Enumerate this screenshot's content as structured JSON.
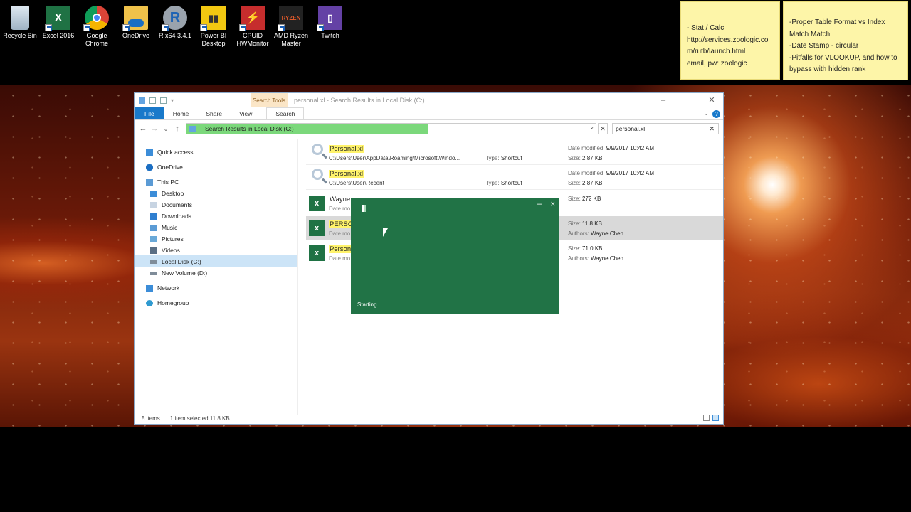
{
  "desktop": {
    "icons": [
      {
        "label": "Recycle Bin",
        "icon": "recycle-bin-icon"
      },
      {
        "label": "Excel 2016",
        "icon": "excel-icon"
      },
      {
        "label": "Google Chrome",
        "icon": "chrome-icon"
      },
      {
        "label": "OneDrive",
        "icon": "onedrive-icon"
      },
      {
        "label": "R x64 3.4.1",
        "icon": "r-icon"
      },
      {
        "label": "Power BI Desktop",
        "icon": "powerbi-icon"
      },
      {
        "label": "CPUID HWMonitor",
        "icon": "hwmonitor-icon"
      },
      {
        "label": "AMD Ryzen Master",
        "icon": "ryzen-icon"
      },
      {
        "label": "Twitch",
        "icon": "twitch-icon"
      }
    ],
    "sticky_notes": [
      {
        "lines": [
          "- Stat / Calc",
          "http://services.zoologic.co",
          "m/rutb/launch.html",
          "email, pw: zoologic"
        ]
      },
      {
        "lines": [
          "-Proper Table Format vs Index",
          "Match Match",
          "-Date Stamp - circular",
          "-Pitfalls for VLOOKUP, and how to",
          "bypass with hidden rank"
        ]
      }
    ]
  },
  "explorer": {
    "title": "personal.xl - Search Results in Local Disk (C:)",
    "contextual_tab": "Search Tools",
    "ribbon_tabs": [
      "File",
      "Home",
      "Share",
      "View",
      "Search"
    ],
    "address": "Search Results in Local Disk (C:)",
    "search_value": "personal.xl",
    "nav": {
      "quick_access": "Quick access",
      "onedrive": "OneDrive",
      "this_pc": "This PC",
      "desktop": "Desktop",
      "documents": "Documents",
      "downloads": "Downloads",
      "music": "Music",
      "pictures": "Pictures",
      "videos": "Videos",
      "local_disk": "Local Disk (C:)",
      "new_volume": "New Volume (D:)",
      "network": "Network",
      "homegroup": "Homegroup"
    },
    "results": [
      {
        "name": "Personal.xl",
        "path": "C:\\Users\\User\\AppData\\Roaming\\Microsoft\\Windo...",
        "type_label": "Type:",
        "type": "Shortcut",
        "meta1_label": "Date modified:",
        "meta1": "9/9/2017 10:42 AM",
        "meta2_label": "Size:",
        "meta2": "2.87 KB"
      },
      {
        "name": "Personal.xl",
        "path": "C:\\Users\\User\\Recent",
        "type_label": "Type:",
        "type": "Shortcut",
        "meta1_label": "Date modified:",
        "meta1": "9/9/2017 10:42 AM",
        "meta2_label": "Size:",
        "meta2": "2.87 KB"
      },
      {
        "name": "Wayne",
        "path": "Date mo",
        "meta1_label": "Size:",
        "meta1": "272 KB"
      },
      {
        "name": "PERSO",
        "path": "Date mo",
        "meta1_label": "Size:",
        "meta1": "11.8 KB",
        "meta2_label": "Authors:",
        "meta2": "Wayne Chen"
      },
      {
        "name": "Person",
        "path": "Date mo",
        "meta1_label": "Size:",
        "meta1": "71.0 KB",
        "meta2_label": "Authors:",
        "meta2": "Wayne Chen"
      }
    ],
    "status": {
      "items": "5 items",
      "selection": "1 item selected  11.8 KB"
    }
  },
  "splash": {
    "status": "Starting...",
    "minimize": "–",
    "close": "×"
  },
  "colors": {
    "excel_green": "#217346",
    "explorer_accent": "#1979ca",
    "highlight": "#fff36b",
    "sticky": "#fdf5a8"
  }
}
